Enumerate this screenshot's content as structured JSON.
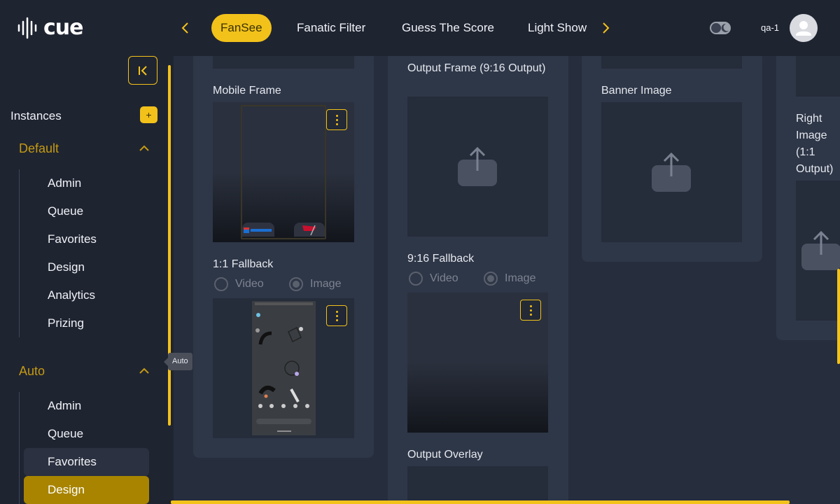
{
  "app": {
    "logo_text": "cue"
  },
  "topnav": {
    "tabs": [
      {
        "label": "FanSee",
        "active": true
      },
      {
        "label": "Fanatic Filter",
        "active": false
      },
      {
        "label": "Guess The Score",
        "active": false
      },
      {
        "label": "Light Show",
        "active": false
      }
    ],
    "username": "qa-1"
  },
  "sidebar": {
    "instances_label": "Instances",
    "add_label": "+",
    "groups": [
      {
        "title": "Default",
        "items": [
          "Admin",
          "Queue",
          "Favorites",
          "Design",
          "Analytics",
          "Prizing"
        ]
      },
      {
        "title": "Auto",
        "items": [
          "Admin",
          "Queue",
          "Favorites",
          "Design"
        ]
      }
    ],
    "tooltip": "Auto"
  },
  "main": {
    "col1": {
      "mobile_frame_label": "Mobile Frame",
      "fallback_label": "1:1 Fallback",
      "radio_video": "Video",
      "radio_image": "Image",
      "selected": "Image"
    },
    "col2": {
      "output_frame_label": "Output Frame (9:16 Output)",
      "fallback_label": "9:16 Fallback",
      "radio_video": "Video",
      "radio_image": "Image",
      "selected": "Image",
      "overlay_label": "Output Overlay"
    },
    "col3": {
      "banner_label": "Banner Image"
    },
    "col4": {
      "right_image_label": "Right Image (1:1 Output)"
    }
  },
  "colors": {
    "accent": "#f2c21b",
    "background": "#1f2431",
    "card": "#2e3748",
    "selected": "#a88400"
  }
}
